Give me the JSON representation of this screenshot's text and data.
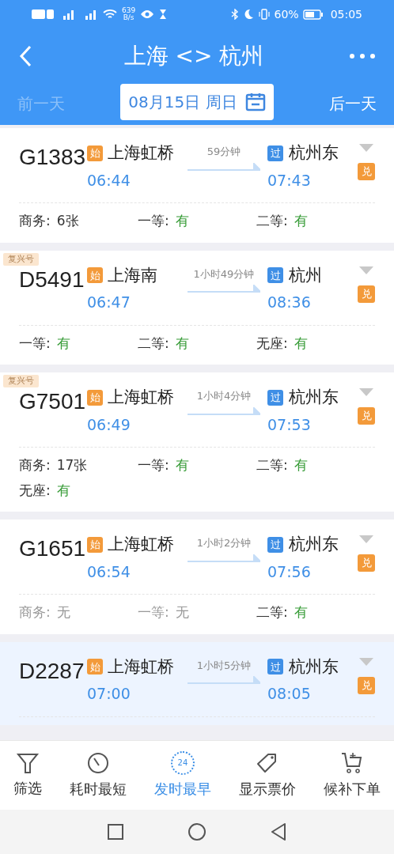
{
  "status_bar": {
    "speed": "639",
    "speed_unit": "B/s",
    "battery": "60%",
    "time": "05:05"
  },
  "header": {
    "title": "上海 <> 杭州",
    "prev_day": {
      "label": "前一天",
      "disabled": true
    },
    "date": "08月15日 周日",
    "next_day": {
      "label": "后一天",
      "disabled": false
    }
  },
  "trains": [
    {
      "number": "G1383",
      "from_badge": "始",
      "from": "上海虹桥",
      "depart": "06:44",
      "duration": "59分钟",
      "to_badge": "过",
      "to": "杭州东",
      "arrive": "07:43",
      "exchange": "兑",
      "selected": false,
      "seats": [
        {
          "label": "商务:",
          "value": "6张",
          "kind": "count"
        },
        {
          "label": "一等:",
          "value": "有",
          "kind": "yes"
        },
        {
          "label": "二等:",
          "value": "有",
          "kind": "yes"
        }
      ]
    },
    {
      "tag": "复兴号",
      "number": "D5491",
      "from_badge": "始",
      "from": "上海南",
      "depart": "06:47",
      "duration": "1小时49分钟",
      "to_badge": "过",
      "to": "杭州",
      "arrive": "08:36",
      "exchange": "兑",
      "selected": false,
      "seats": [
        {
          "label": "一等:",
          "value": "有",
          "kind": "yes"
        },
        {
          "label": "二等:",
          "value": "有",
          "kind": "yes"
        },
        {
          "label": "无座:",
          "value": "有",
          "kind": "yes"
        }
      ]
    },
    {
      "tag": "复兴号",
      "number": "G7501",
      "from_badge": "始",
      "from": "上海虹桥",
      "depart": "06:49",
      "duration": "1小时4分钟",
      "to_badge": "过",
      "to": "杭州东",
      "arrive": "07:53",
      "exchange": "兑",
      "selected": false,
      "seats": [
        {
          "label": "商务:",
          "value": "17张",
          "kind": "count"
        },
        {
          "label": "一等:",
          "value": "有",
          "kind": "yes"
        },
        {
          "label": "二等:",
          "value": "有",
          "kind": "yes"
        },
        {
          "label": "无座:",
          "value": "有",
          "kind": "yes"
        }
      ]
    },
    {
      "number": "G1651",
      "from_badge": "始",
      "from": "上海虹桥",
      "depart": "06:54",
      "duration": "1小时2分钟",
      "to_badge": "过",
      "to": "杭州东",
      "arrive": "07:56",
      "exchange": "兑",
      "selected": false,
      "seats": [
        {
          "label": "商务:",
          "value": "无",
          "kind": "none"
        },
        {
          "label": "一等:",
          "value": "无",
          "kind": "none"
        },
        {
          "label": "二等:",
          "value": "有",
          "kind": "yes"
        }
      ]
    },
    {
      "number": "D2287",
      "from_badge": "始",
      "from": "上海虹桥",
      "depart": "07:00",
      "duration": "1小时5分钟",
      "to_badge": "过",
      "to": "杭州东",
      "arrive": "08:05",
      "exchange": "兑",
      "selected": true
    }
  ],
  "bottom_tabs": [
    {
      "kind": "filter",
      "label": "筛选",
      "selected": false
    },
    {
      "kind": "duration",
      "label": "耗时最短",
      "selected": false
    },
    {
      "kind": "clock24",
      "label": "发时最早",
      "icon_text": "24",
      "selected": true
    },
    {
      "kind": "price",
      "label": "显示票价",
      "selected": false
    },
    {
      "kind": "cart",
      "label": "候补下单",
      "selected": false
    }
  ]
}
